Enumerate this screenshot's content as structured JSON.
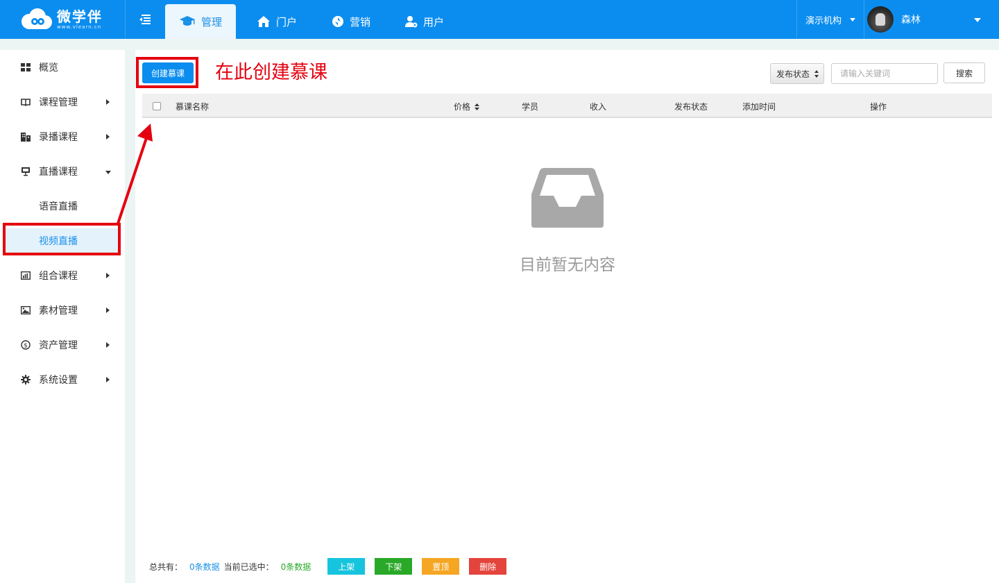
{
  "brand": {
    "name": "微学伴",
    "sub": "www.vlearn.cn"
  },
  "nav": {
    "items": [
      {
        "label": "管理",
        "icon": "graduation-cap-icon"
      },
      {
        "label": "门户",
        "icon": "home-icon"
      },
      {
        "label": "营销",
        "icon": "marketing-icon"
      },
      {
        "label": "用户",
        "icon": "user-gear-icon"
      }
    ],
    "active_index": 0
  },
  "header": {
    "org": "演示机构",
    "user": "森林"
  },
  "sidebar": {
    "items": [
      {
        "label": "概览",
        "icon": "grid-icon"
      },
      {
        "label": "课程管理",
        "icon": "book-icon"
      },
      {
        "label": "录播课程",
        "icon": "building-icon"
      },
      {
        "label": "直播课程",
        "icon": "presentation-icon"
      },
      {
        "label": "语音直播"
      },
      {
        "label": "视频直播"
      },
      {
        "label": "组合课程",
        "icon": "bar-chart-icon"
      },
      {
        "label": "素材管理",
        "icon": "image-icon"
      },
      {
        "label": "资产管理",
        "icon": "dollar-icon"
      },
      {
        "label": "系统设置",
        "icon": "gear-icon"
      }
    ],
    "active_label": "视频直播"
  },
  "toolbar": {
    "create_label": "创建慕课",
    "annotation": "在此创建慕课",
    "status_label": "发布状态",
    "keyword_placeholder": "请输入关键词",
    "search_label": "搜索"
  },
  "table": {
    "columns": [
      "慕课名称",
      "价格",
      "学员",
      "收入",
      "发布状态",
      "添加时间",
      "操作"
    ],
    "rows": []
  },
  "empty": {
    "message": "目前暂无内容"
  },
  "footer": {
    "total_label": "总共有：",
    "total_count": "0条数据",
    "selected_label": "当前已选中：",
    "selected_count": "0条数据",
    "buttons": {
      "publish": "上架",
      "unpublish": "下架",
      "pin": "置顶",
      "delete": "删除"
    }
  },
  "colors": {
    "primary": "#0b8def",
    "annotation": "#e4000f",
    "publish": "#17c4dd",
    "unpublish": "#2aa928",
    "pin": "#f5a623",
    "delete": "#e3443c"
  }
}
